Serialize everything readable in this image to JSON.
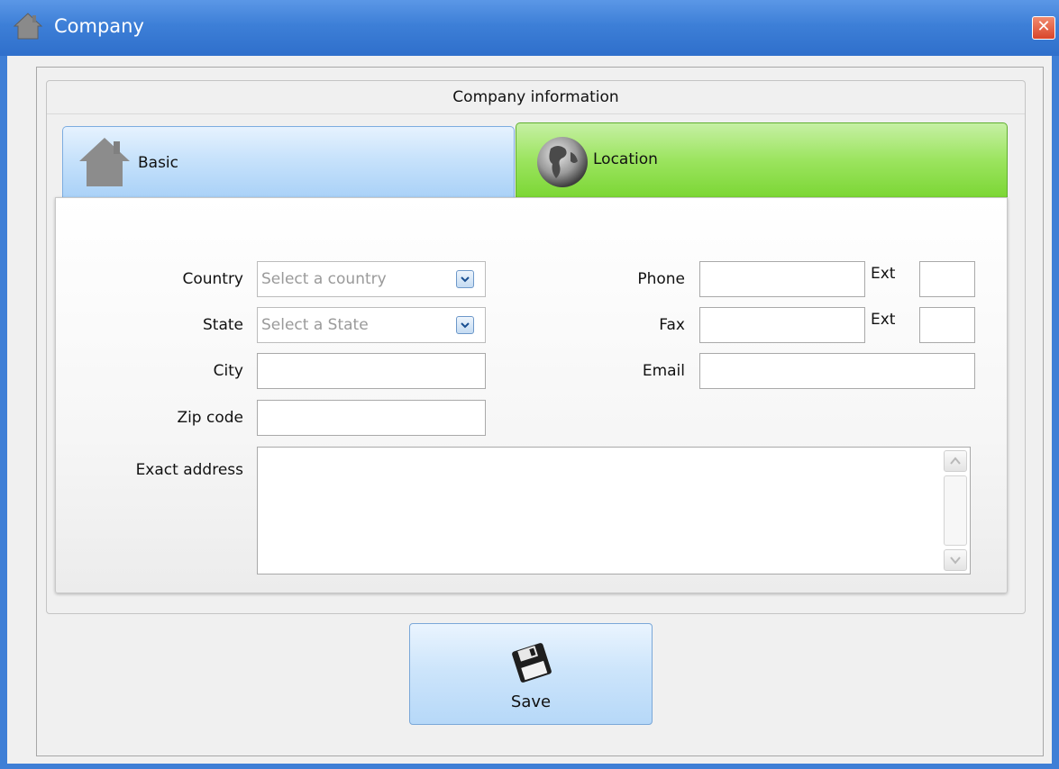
{
  "window": {
    "title": "Company",
    "close_icon": "close-icon",
    "app_icon": "house-icon"
  },
  "group": {
    "title": "Company information"
  },
  "tabs": [
    {
      "label": "Basic",
      "icon": "house-icon",
      "active": false
    },
    {
      "label": "Location",
      "icon": "globe-icon",
      "active": true
    }
  ],
  "form": {
    "country": {
      "label": "Country",
      "placeholder": "Select a country"
    },
    "state": {
      "label": "State",
      "placeholder": "Select a State"
    },
    "city": {
      "label": "City",
      "value": ""
    },
    "zip": {
      "label": "Zip code",
      "value": ""
    },
    "address": {
      "label": "Exact address",
      "value": ""
    },
    "phone": {
      "label": "Phone",
      "value": "",
      "ext_label": "Ext",
      "ext_value": ""
    },
    "fax": {
      "label": "Fax",
      "value": "",
      "ext_label": "Ext",
      "ext_value": ""
    },
    "email": {
      "label": "Email",
      "value": ""
    }
  },
  "save_button": {
    "label": "Save",
    "icon": "floppy-disk-icon"
  },
  "colors": {
    "titlebar": "#3d7fd7",
    "tab_basic": "#c7e2fb",
    "tab_location": "#9be45e",
    "client_bg": "#f0f0f0"
  }
}
